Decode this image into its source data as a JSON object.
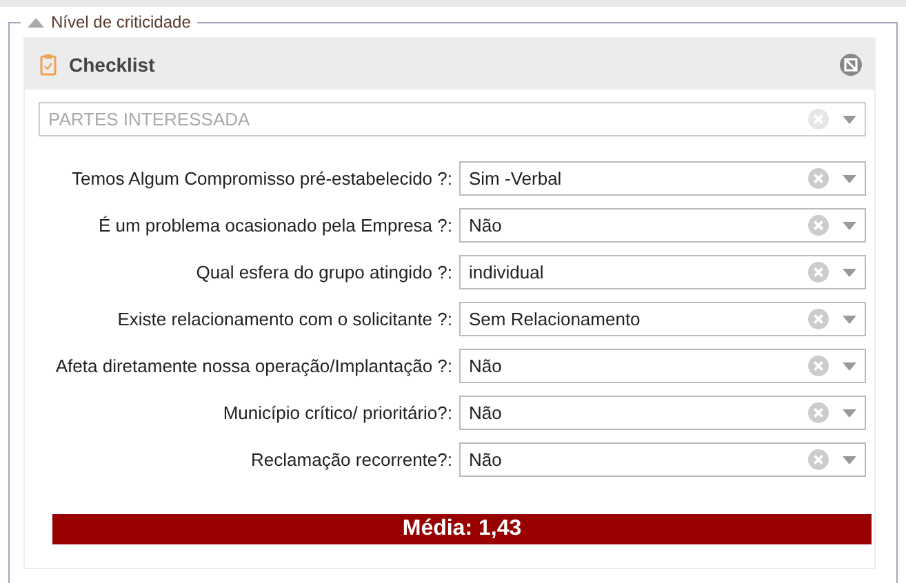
{
  "fieldset": {
    "legend": "Nível de criticidade",
    "expanded": true
  },
  "panel": {
    "title": "Checklist"
  },
  "top_select": {
    "placeholder": "PARTES INTERESSADA",
    "disabled": true
  },
  "questions": [
    {
      "label": "Temos Algum Compromisso pré-estabelecido ?:",
      "value": "Sim -Verbal"
    },
    {
      "label": "É um problema ocasionado pela Empresa ?:",
      "value": "Não"
    },
    {
      "label": "Qual esfera do grupo atingido ?:",
      "value": "individual"
    },
    {
      "label": "Existe relacionamento com o solicitante ?:",
      "value": "Sem Relacionamento"
    },
    {
      "label": "Afeta diretamente nossa operação/Implantação ?:",
      "value": "Não"
    },
    {
      "label": "Município crítico/ prioritário?:",
      "value": "Não"
    },
    {
      "label": "Reclamação recorrente?:",
      "value": "Não"
    }
  ],
  "average": {
    "text": "Média: 1,43",
    "color": "#990000"
  }
}
